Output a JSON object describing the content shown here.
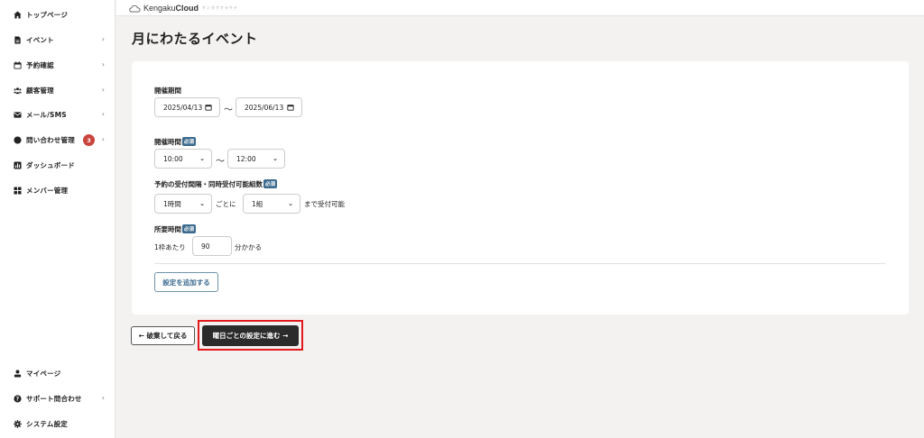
{
  "sidebar": {
    "items": [
      {
        "label": "トップページ",
        "icon": "home-icon",
        "chevron": ""
      },
      {
        "label": "イベント",
        "icon": "document-icon",
        "chevron": "›"
      },
      {
        "label": "予約確認",
        "icon": "calendar-icon",
        "chevron": "›"
      },
      {
        "label": "顧客管理",
        "icon": "users-icon",
        "chevron": "›"
      },
      {
        "label": "メール/SMS",
        "icon": "envelope-icon",
        "chevron": "›"
      },
      {
        "label": "問い合わせ管理",
        "icon": "chat-icon",
        "chevron": "›",
        "badge": "3"
      },
      {
        "label": "ダッシュボード",
        "icon": "chart-icon",
        "chevron": ""
      },
      {
        "label": "メンバー管理",
        "icon": "grid-icon",
        "chevron": ""
      }
    ],
    "bottom_items": [
      {
        "label": "マイページ",
        "icon": "person-icon",
        "chevron": ""
      },
      {
        "label": "サポート問合わせ",
        "icon": "help-icon",
        "chevron": "›"
      },
      {
        "label": "システム設定",
        "icon": "gear-icon",
        "chevron": ""
      }
    ]
  },
  "header": {
    "logo_text_regular": "Kengaku",
    "logo_text_bold": "Cloud",
    "logo_sub": "ケンガククラウド"
  },
  "page": {
    "title": "月にわたるイベント"
  },
  "form": {
    "period_label": "開催期間",
    "start_date": "2025/04/13",
    "end_date": "2025/06/13",
    "tilde": "〜",
    "time_label": "開催時間",
    "required_badge": "必須",
    "start_time": "10:00",
    "end_time": "12:00",
    "interval_label": "予約の受付間隔・同時受付可能組数",
    "interval_value": "1時間",
    "per_text": "ごとに",
    "groups_value": "1組",
    "until_text": "まで受付可能",
    "duration_label": "所要時間",
    "per_slot_text": "1枠あたり",
    "duration_value": "90",
    "takes_text": "分かかる",
    "add_setting_button": "設定を追加する"
  },
  "actions": {
    "back_button": "← 破棄して戻る",
    "next_button": "曜日ごとの設定に進む →"
  },
  "colors": {
    "accent_blue": "#3b6a8e",
    "badge_red": "#c9443c",
    "highlight_red": "#e3191e",
    "primary_dark": "#2b2b2b"
  }
}
